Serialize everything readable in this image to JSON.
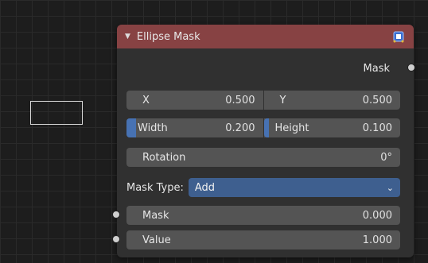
{
  "node": {
    "title": "Ellipse Mask",
    "output_label": "Mask",
    "x": {
      "label": "X",
      "value": "0.500"
    },
    "y": {
      "label": "Y",
      "value": "0.500"
    },
    "width": {
      "label": "Width",
      "value": "0.200",
      "fill": 0.2
    },
    "height": {
      "label": "Height",
      "value": "0.100",
      "fill": 0.1
    },
    "rotation": {
      "label": "Rotation",
      "value": "0°"
    },
    "mask_type": {
      "label": "Mask Type:",
      "value": "Add"
    },
    "mask_input": {
      "label": "Mask",
      "value": "0.000"
    },
    "value_input": {
      "label": "Value",
      "value": "1.000"
    }
  },
  "colors": {
    "header": "#874243",
    "accent": "#4772b3",
    "dropdown": "#3e5f8f"
  }
}
